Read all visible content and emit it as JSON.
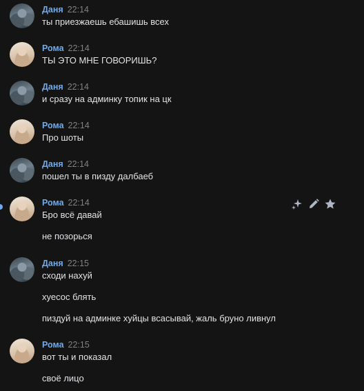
{
  "messages": [
    {
      "author": "Даня",
      "time": "22:14",
      "avatar": "danya",
      "lines": [
        "ты приезжаешь ебашишь всех"
      ]
    },
    {
      "author": "Рома",
      "time": "22:14",
      "avatar": "roma",
      "lines": [
        "ТЫ ЭТО МНЕ ГОВОРИШЬ?"
      ]
    },
    {
      "author": "Даня",
      "time": "22:14",
      "avatar": "danya",
      "lines": [
        "и сразу на админку топик на цк"
      ]
    },
    {
      "author": "Рома",
      "time": "22:14",
      "avatar": "roma",
      "lines": [
        "Про шоты"
      ]
    },
    {
      "author": "Даня",
      "time": "22:14",
      "avatar": "danya",
      "lines": [
        "пошел ты в пизду далбаеб"
      ]
    },
    {
      "author": "Рома",
      "time": "22:14",
      "avatar": "roma",
      "lines": [
        "Бро всё давай",
        "не позорься"
      ]
    },
    {
      "author": "Даня",
      "time": "22:15",
      "avatar": "danya",
      "lines": [
        "сходи нахуй",
        "хуесос блять",
        "пиздуй на админке хуйцы всасывай, жаль бруно ливнул"
      ]
    },
    {
      "author": "Рома",
      "time": "22:15",
      "avatar": "roma",
      "lines": [
        "вот ты и показал",
        "своё лицо"
      ]
    }
  ],
  "hover_actions": {
    "icons": [
      "sparkle-icon",
      "pencil-icon",
      "star-icon"
    ],
    "color": "#aeb7c2"
  },
  "colors": {
    "background": "#141414",
    "author": "#71aaeb",
    "time": "#828282",
    "text": "#e1e3e6"
  }
}
